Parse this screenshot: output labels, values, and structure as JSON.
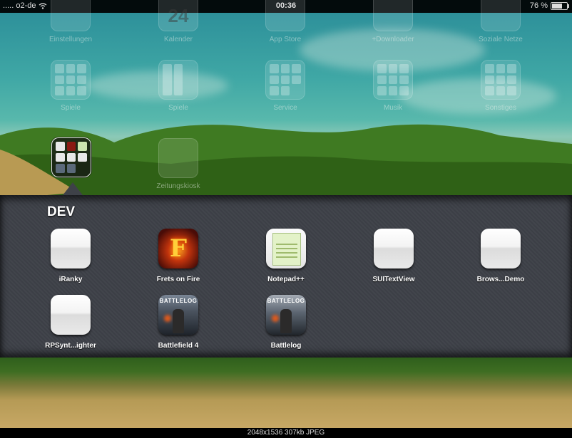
{
  "status_bar": {
    "carrier": "..... o2-de",
    "time": "00:36",
    "battery": "76 %",
    "battery_level": 0.76,
    "wifi_icon": "wifi-icon"
  },
  "home_top_row": [
    {
      "label": "Einstellungen"
    },
    {
      "label": "Kalender",
      "number": "24"
    },
    {
      "label": "App Store"
    },
    {
      "label": "+Downloader"
    },
    {
      "label": "Soziale Netze"
    }
  ],
  "home_second_row": [
    {
      "label": "Spiele"
    },
    {
      "label": "Spiele"
    },
    {
      "label": "Service"
    },
    {
      "label": "Musik"
    },
    {
      "label": "Sonstiges"
    }
  ],
  "home_third_row": [
    {
      "label": "Zeitungskiosk"
    }
  ],
  "folder": {
    "title": "DEV",
    "apps": [
      {
        "label": "iRanky",
        "icon": "blank-app-icon"
      },
      {
        "label": "Frets on Fire",
        "icon": "frets-on-fire-icon",
        "glyph": "F"
      },
      {
        "label": "Notepad++",
        "icon": "notepad-plus-plus-icon"
      },
      {
        "label": "SUITextView",
        "icon": "blank-app-icon"
      },
      {
        "label": "Brows...Demo",
        "icon": "blank-app-icon"
      },
      {
        "label": "RPSynt...ighter",
        "icon": "blank-app-icon"
      },
      {
        "label": "Battlefield 4",
        "icon": "battlefield-4-icon",
        "badge": "BATTLELOG"
      },
      {
        "label": "Battlelog",
        "icon": "battlelog-icon",
        "badge": "BATTLELOG"
      }
    ]
  },
  "image_info": "2048x1536  307kb  JPEG"
}
